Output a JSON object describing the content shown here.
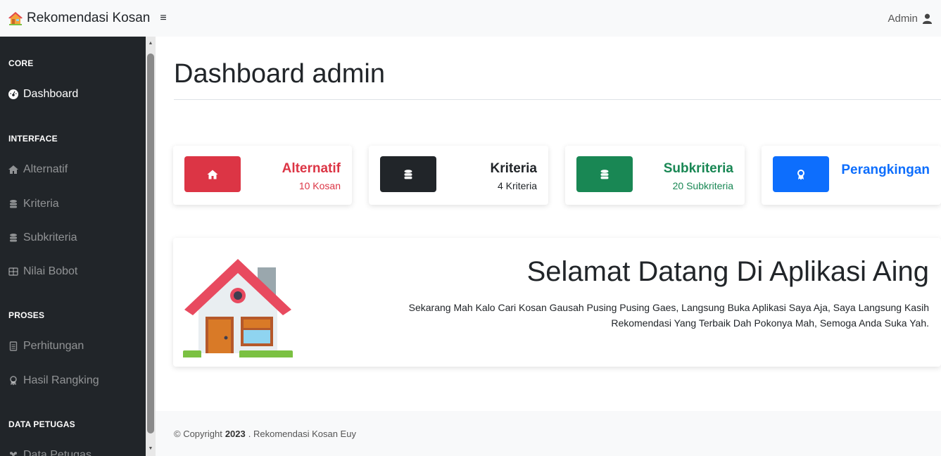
{
  "navbar": {
    "brand": "Rekomendasi Kosan",
    "brand_icon": "house-icon",
    "toggle_icon": "hamburger-icon",
    "toggle_glyph": "≡",
    "user": "Admin",
    "user_icon": "user-icon"
  },
  "sidebar": {
    "sections": [
      {
        "heading": "CORE"
      },
      {
        "heading": "INTERFACE"
      },
      {
        "heading": "PROSES"
      },
      {
        "heading": "DATA PETUGAS"
      }
    ],
    "items": [
      {
        "label": "Dashboard",
        "icon": "tachometer-icon",
        "active": true
      },
      {
        "label": "Alternatif",
        "icon": "home-icon"
      },
      {
        "label": "Kriteria",
        "icon": "database-icon"
      },
      {
        "label": "Subkriteria",
        "icon": "database-icon"
      },
      {
        "label": "Nilai Bobot",
        "icon": "table-icon"
      },
      {
        "label": "Perhitungan",
        "icon": "file-icon"
      },
      {
        "label": "Hasil Rangking",
        "icon": "award-icon"
      },
      {
        "label": "Data Petugas",
        "icon": "users-icon"
      }
    ]
  },
  "page": {
    "title": "Dashboard admin"
  },
  "cards": [
    {
      "title": "Alternatif",
      "subtitle": "10 Kosan",
      "color": "#dc3545",
      "text_color": "#dc3545",
      "icon": "home-icon"
    },
    {
      "title": "Kriteria",
      "subtitle": "4 Kriteria",
      "color": "#212529",
      "text_color": "#212529",
      "icon": "database-icon"
    },
    {
      "title": "Subkriteria",
      "subtitle": "20 Subkriteria",
      "color": "#198754",
      "text_color": "#198754",
      "icon": "database-icon"
    },
    {
      "title": "Perangkingan",
      "subtitle": "",
      "color": "#0d6efd",
      "text_color": "#0d6efd",
      "icon": "award-icon"
    }
  ],
  "welcome": {
    "title": "Selamat Datang Di Aplikasi Aing",
    "text": "Sekarang Mah Kalo Cari Kosan Gausah Pusing Pusing Gaes, Langsung Buka Aplikasi Saya Aja, Saya Langsung Kasih Rekomendasi Yang Terbaik Dah Pokonya Mah, Semoga Anda Suka Yah.",
    "illustration": "house-illustration"
  },
  "footer": {
    "prefix": "© Copyright",
    "year": "2023",
    "suffix": ". Rekomendasi Kosan Euy"
  }
}
